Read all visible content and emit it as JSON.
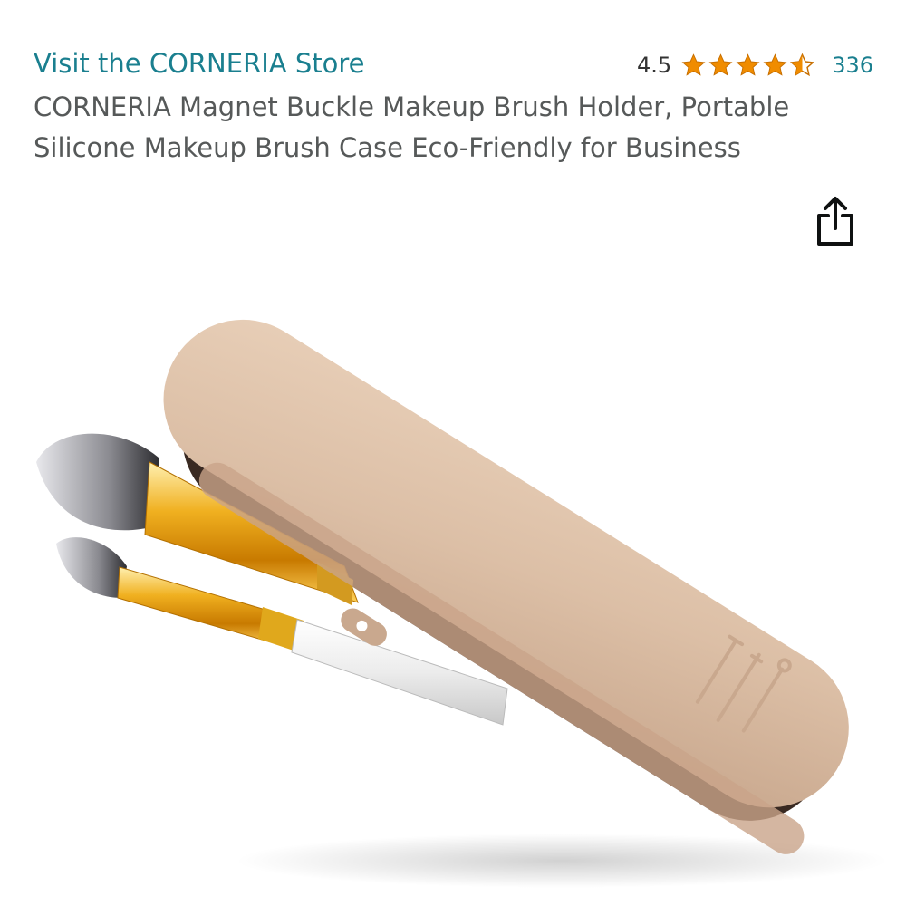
{
  "store": {
    "link_text": "Visit the CORNERIA Store"
  },
  "rating": {
    "value": "4.5",
    "stars_out_of_5": 4.5,
    "review_count": "336",
    "star_color": "#f08c00"
  },
  "product": {
    "title": "CORNERIA Magnet Buckle Makeup Brush Holder, Portable Silicone Makeup Brush Case Eco-Friendly for Business"
  },
  "icons": {
    "share": "share-icon"
  },
  "colors": {
    "link": "#1a7f8f",
    "title_text": "#565959",
    "case_color": "#dcbfa6"
  }
}
